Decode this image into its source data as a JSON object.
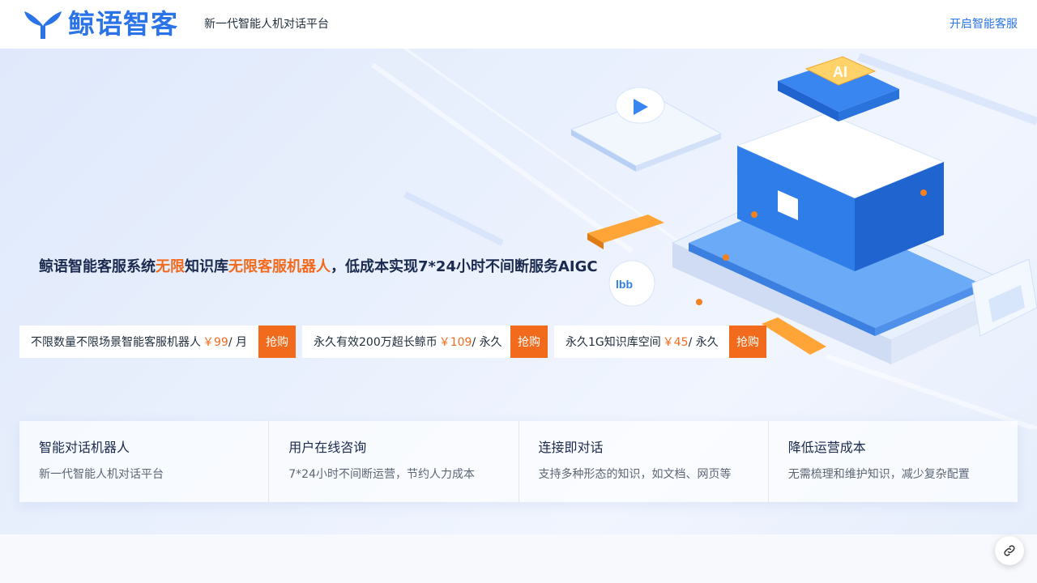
{
  "header": {
    "logo_text": "鲸语智客",
    "tagline": "新一代智能人机对话平台",
    "cta_link": "开启智能客服"
  },
  "hero": {
    "headline": {
      "part1": "鲸语智能客服系统",
      "highlight1": "无限",
      "part2": "知识库",
      "highlight2": "无限客服机器人",
      "part3": "，低成本实现7*24小时不间断服务AIGC"
    },
    "offers": [
      {
        "text": "不限数量不限场景智能客服机器人",
        "price": "￥99",
        "unit": "/ 月",
        "button": "抢购"
      },
      {
        "text": "永久有效200万超长鲸币",
        "price": "￥109",
        "unit": "/ 永久",
        "button": "抢购"
      },
      {
        "text": "永久1G知识库空间",
        "price": "￥45",
        "unit": "/ 永久",
        "button": "抢购"
      }
    ]
  },
  "features": [
    {
      "title": "智能对话机器人",
      "desc": "新一代智能人机对话平台"
    },
    {
      "title": "用户在线咨询",
      "desc": "7*24小时不间断运营，节约人力成本"
    },
    {
      "title": "连接即对话",
      "desc": "支持多种形态的知识，如文档、网页等"
    },
    {
      "title": "降低运营成本",
      "desc": "无需梳理和维护知识，减少复杂配置"
    }
  ],
  "icons": {
    "logo": "whale-tail-icon",
    "float": "link-icon"
  },
  "colors": {
    "brand": "#2b74e8",
    "accent": "#f26b1d"
  }
}
